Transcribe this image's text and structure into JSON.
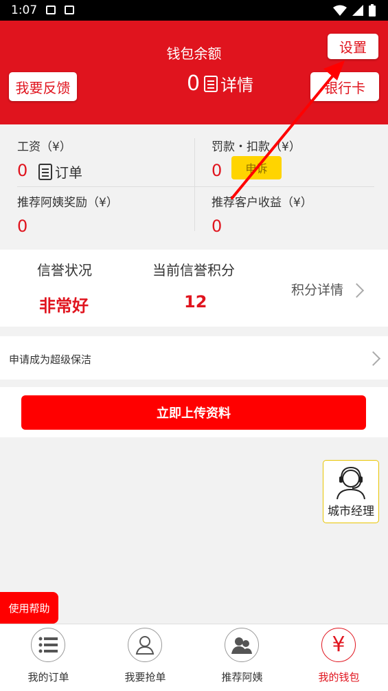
{
  "status_bar": {
    "time": "1:07"
  },
  "header": {
    "title": "钱包余额",
    "balance": "0",
    "detail_label": "详情",
    "feedback_button": "我要反馈",
    "settings_button": "设置",
    "bank_card_button": "银行卡"
  },
  "stats": {
    "salary": {
      "label": "工资（¥）",
      "value": "0",
      "order_label": "订单"
    },
    "penalty": {
      "label": "罚款・扣款（¥）",
      "value": "0",
      "appeal_button": "申诉"
    },
    "referral_aunt": {
      "label": "推荐阿姨奖励（¥）",
      "value": "0"
    },
    "referral_customer": {
      "label": "推荐客户收益（¥）",
      "value": "0"
    }
  },
  "credit": {
    "status_label": "信誉状况",
    "status_value": "非常好",
    "score_label": "当前信誉积分",
    "score_value": "12",
    "details_link": "积分详情"
  },
  "apply_super_cleaner": "申请成为超级保洁",
  "upload_button": "立即上传资料",
  "city_manager": {
    "label": "城市经理"
  },
  "help_button": "使用帮助",
  "tabs": [
    {
      "label": "我的订单",
      "icon": "list-icon"
    },
    {
      "label": "我要抢单",
      "icon": "user-icon"
    },
    {
      "label": "推荐阿姨",
      "icon": "group-icon"
    },
    {
      "label": "我的钱包",
      "icon": "yuan-icon",
      "active": true
    }
  ],
  "colors": {
    "brand_red": "#e0141e",
    "upload_red": "#ff0000",
    "appeal_yellow": "#ffd400"
  }
}
